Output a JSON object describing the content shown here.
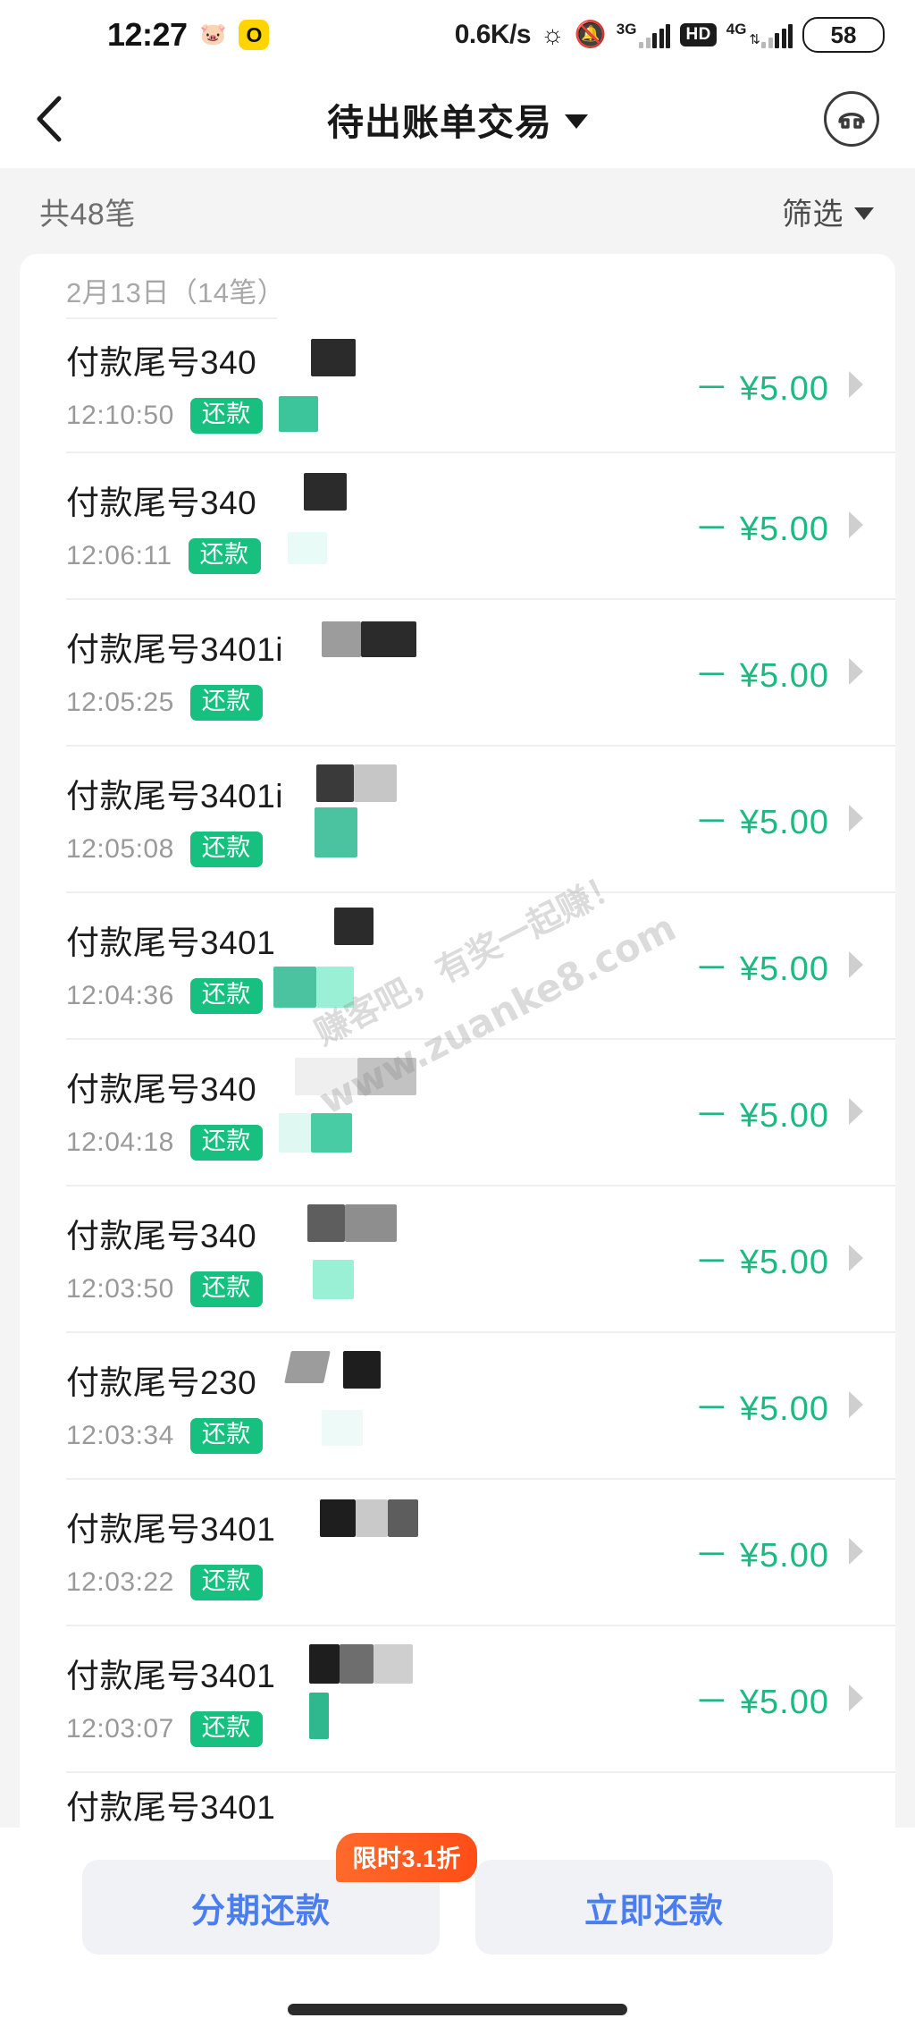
{
  "status_bar": {
    "time": "12:27",
    "pig_icon": "pig-icon",
    "ring_icon_label": "O",
    "network_speed": "0.6K/s",
    "bluetooth_icon": "bluetooth-icon",
    "mute_icon": "mute-bell-icon",
    "sim1_label": "3G",
    "hd_label": "HD",
    "sim2_label": "4G",
    "battery": "58"
  },
  "nav": {
    "back_icon": "chevron-left-icon",
    "title": "待出账单交易",
    "caret_icon": "chevron-down-icon",
    "avatar_icon": "customer-service-icon"
  },
  "summary": {
    "count_label": "共48笔",
    "filter_label": "筛选",
    "filter_caret_icon": "chevron-down-icon"
  },
  "list": {
    "date_header": "2月13日（14笔）",
    "rows": [
      {
        "title": "付款尾号340",
        "time": "12:10:50",
        "tag": "还款",
        "amount": "－ ¥5.00"
      },
      {
        "title": "付款尾号340",
        "time": "12:06:11",
        "tag": "还款",
        "amount": "－ ¥5.00"
      },
      {
        "title": "付款尾号3401i",
        "time": "12:05:25",
        "tag": "还款",
        "amount": "－ ¥5.00"
      },
      {
        "title": "付款尾号3401i",
        "time": "12:05:08",
        "tag": "还款",
        "amount": "－ ¥5.00"
      },
      {
        "title": "付款尾号3401",
        "time": "12:04:36",
        "tag": "还款",
        "amount": "－ ¥5.00"
      },
      {
        "title": "付款尾号340",
        "time": "12:04:18",
        "tag": "还款",
        "amount": "－ ¥5.00"
      },
      {
        "title": "付款尾号340",
        "time": "12:03:50",
        "tag": "还款",
        "amount": "－ ¥5.00"
      },
      {
        "title": "付款尾号230",
        "time": "12:03:34",
        "tag": "还款",
        "amount": "－ ¥5.00"
      },
      {
        "title": "付款尾号3401",
        "time": "12:03:22",
        "tag": "还款",
        "amount": "－ ¥5.00"
      },
      {
        "title": "付款尾号3401",
        "time": "12:03:07",
        "tag": "还款",
        "amount": "－ ¥5.00"
      }
    ],
    "cut_row_title": "付款尾号3401"
  },
  "watermark": {
    "line1": "赚客吧，有奖一起赚！",
    "line2": "www.zuanke8.com"
  },
  "bottom": {
    "installment_label": "分期还款",
    "installment_promo": "限时3.1折",
    "repay_now_label": "立即还款"
  },
  "colors": {
    "accent_green": "#1EB980",
    "tag_green": "#17C07F",
    "button_blue": "#4a7ef0",
    "promo_orange": "#FF4D17"
  }
}
